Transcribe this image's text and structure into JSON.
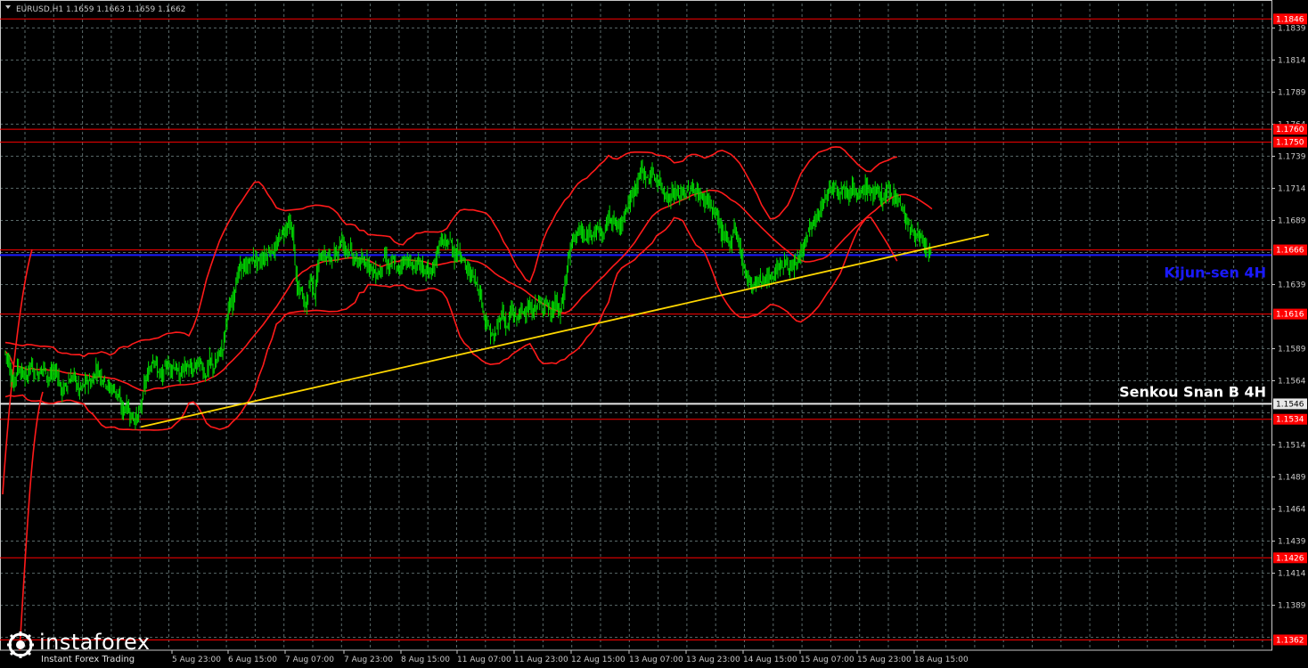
{
  "chart_data": {
    "type": "candlestick",
    "symbol_header": "EURUSD,H1  1.1659 1.1663 1.1659 1.1662",
    "ylim": [
      1.1362,
      1.1858
    ],
    "x_ticks": [
      "5 Aug 23:00",
      "6 Aug 15:00",
      "7 Aug 07:00",
      "7 Aug 23:00",
      "8 Aug 15:00",
      "11 Aug 07:00",
      "11 Aug 23:00",
      "12 Aug 15:00",
      "13 Aug 07:00",
      "13 Aug 23:00",
      "14 Aug 15:00",
      "15 Aug 07:00",
      "15 Aug 23:00",
      "18 Aug 15:00"
    ],
    "y_ticks": [
      "1.1839",
      "1.1814",
      "1.1789",
      "1.1764",
      "1.1739",
      "1.1714",
      "1.1689",
      "1.1639",
      "1.1589",
      "1.1564",
      "1.1514",
      "1.1489",
      "1.1464",
      "1.1439",
      "1.1414",
      "1.1389"
    ],
    "levels": [
      {
        "value": 1.1846,
        "label": "1.1846",
        "color": "#ff0000"
      },
      {
        "value": 1.176,
        "label": "1.1760",
        "color": "#ff0000"
      },
      {
        "value": 1.175,
        "label": "1.1750",
        "color": "#ff0000"
      },
      {
        "value": 1.1666,
        "label": "1.1666",
        "color": "#ff0000"
      },
      {
        "value": 1.1616,
        "label": "1.1616",
        "color": "#ff0000"
      },
      {
        "value": 1.1534,
        "label": "1.1534",
        "color": "#ff0000"
      },
      {
        "value": 1.1426,
        "label": "1.1426",
        "color": "#ff0000"
      },
      {
        "value": 1.1362,
        "label": "1.1362",
        "color": "#ff0000"
      }
    ],
    "kijun_sen_4h": {
      "value": 1.1662,
      "label": "Kijun-sen 4H",
      "color": "#1a1aff"
    },
    "senkou_span_b_4h": {
      "value": 1.1546,
      "label": "Senkou Snan B 4H",
      "axis_label": "1.1546",
      "color": "#e8e8e8"
    },
    "trendline": {
      "color": "#ffd700",
      "from": {
        "bar": 31,
        "price": 1.1528
      },
      "to": {
        "bar": 225,
        "price": 1.1678
      }
    },
    "price_path": [
      1.1587,
      1.1579,
      1.156,
      1.1575,
      1.157,
      1.1566,
      1.1578,
      1.1568,
      1.1571,
      1.1575,
      1.1566,
      1.157,
      1.1572,
      1.1555,
      1.156,
      1.1565,
      1.1568,
      1.1556,
      1.156,
      1.1564,
      1.1562,
      1.1574,
      1.1568,
      1.1564,
      1.1558,
      1.1558,
      1.1553,
      1.154,
      1.1545,
      1.1536,
      1.1534,
      1.154,
      1.156,
      1.157,
      1.1583,
      1.1573,
      1.1566,
      1.1577,
      1.1574,
      1.1576,
      1.1567,
      1.1575,
      1.1575,
      1.1571,
      1.1578,
      1.1577,
      1.1567,
      1.158,
      1.1573,
      1.1585,
      1.159,
      1.1618,
      1.1623,
      1.1641,
      1.1654,
      1.1651,
      1.1656,
      1.166,
      1.1656,
      1.1659,
      1.1662,
      1.1666,
      1.1665,
      1.1677,
      1.1681,
      1.1687,
      1.1679,
      1.1634,
      1.1634,
      1.1621,
      1.1646,
      1.1631,
      1.166,
      1.1662,
      1.166,
      1.1661,
      1.1663,
      1.1675,
      1.1667,
      1.1667,
      1.1658,
      1.1657,
      1.1656,
      1.1658,
      1.1651,
      1.1647,
      1.1649,
      1.1662,
      1.1651,
      1.1658,
      1.1649,
      1.1657,
      1.1658,
      1.1654,
      1.1653,
      1.1656,
      1.165,
      1.165,
      1.1647,
      1.1665,
      1.1674,
      1.1669,
      1.1674,
      1.1661,
      1.1666,
      1.1658,
      1.1649,
      1.1647,
      1.1641,
      1.163,
      1.1611,
      1.1603,
      1.1596,
      1.1609,
      1.1618,
      1.1604,
      1.162,
      1.1612,
      1.1617,
      1.1619,
      1.162,
      1.1617,
      1.1626,
      1.1621,
      1.1626,
      1.1614,
      1.1626,
      1.1616,
      1.1632,
      1.1659,
      1.1674,
      1.168,
      1.168,
      1.1673,
      1.1681,
      1.168,
      1.1683,
      1.1675,
      1.1691,
      1.1691,
      1.1685,
      1.1684,
      1.1698,
      1.1703,
      1.1711,
      1.1722,
      1.1729,
      1.172,
      1.1725,
      1.1721,
      1.1718,
      1.1711,
      1.1705,
      1.1712,
      1.1708,
      1.1711,
      1.171,
      1.1714,
      1.1712,
      1.1709,
      1.1704,
      1.1707,
      1.1695,
      1.1695,
      1.1679,
      1.1676,
      1.167,
      1.1684,
      1.1673,
      1.1654,
      1.1646,
      1.1637,
      1.1641,
      1.1643,
      1.1643,
      1.1644,
      1.1646,
      1.1654,
      1.1653,
      1.1657,
      1.1649,
      1.1654,
      1.1662,
      1.167,
      1.1681,
      1.1686,
      1.1691,
      1.17,
      1.1708,
      1.1715,
      1.1717,
      1.1711,
      1.1715,
      1.1709,
      1.1716,
      1.1706,
      1.171,
      1.1715,
      1.1712,
      1.1709,
      1.1712,
      1.1705,
      1.1713,
      1.171,
      1.1707,
      1.1702,
      1.1692,
      1.1683,
      1.168,
      1.1677,
      1.1672,
      1.1666,
      1.1662
    ]
  },
  "logo": {
    "brand": "instaforex",
    "slogan": "Instant Forex Trading"
  },
  "colors": {
    "background": "#000000",
    "grid": "#5a6a6a",
    "candles": "#00e000",
    "bollinger": "#ff1a1a",
    "trendline": "#ffd700",
    "kijun": "#1a1aff",
    "senkou": "#e8e8e8",
    "level": "#ff0000",
    "axis_text": "#c8c8c8"
  }
}
